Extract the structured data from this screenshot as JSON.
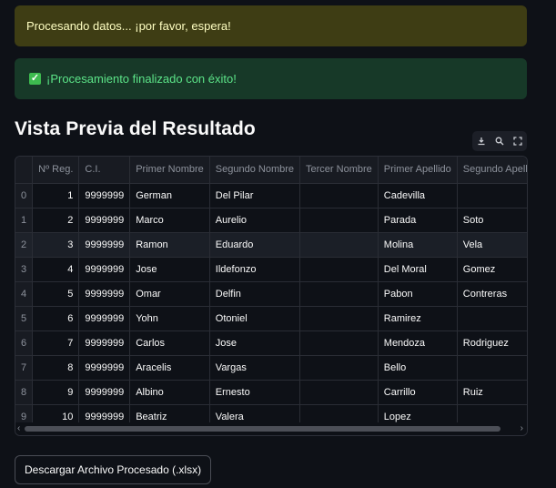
{
  "alerts": {
    "processing": "Procesando datos... ¡por favor, espera!",
    "success": "¡Procesamiento finalizado con éxito!"
  },
  "title": "Vista Previa del Resultado",
  "toolbar": {
    "icons": [
      "download-icon",
      "search-icon",
      "fullscreen-icon"
    ]
  },
  "table": {
    "columns": [
      "",
      "Nº Reg.",
      "C.I.",
      "Primer Nombre",
      "Segundo Nombre",
      "Tercer Nombre",
      "Primer Apellido",
      "Segundo Apellido"
    ],
    "rows": [
      [
        "0",
        "1",
        "9999999",
        "German",
        "Del Pilar",
        "",
        "Cadevilla",
        ""
      ],
      [
        "1",
        "2",
        "9999999",
        "Marco",
        "Aurelio",
        "",
        "Parada",
        "Soto"
      ],
      [
        "2",
        "3",
        "9999999",
        "Ramon",
        "Eduardo",
        "",
        "Molina",
        "Vela"
      ],
      [
        "3",
        "4",
        "9999999",
        "Jose",
        "Ildefonzo",
        "",
        "Del Moral",
        "Gomez"
      ],
      [
        "4",
        "5",
        "9999999",
        "Omar",
        "Delfin",
        "",
        "Pabon",
        "Contreras"
      ],
      [
        "5",
        "6",
        "9999999",
        "Yohn",
        "Otoniel",
        "",
        "Ramirez",
        ""
      ],
      [
        "6",
        "7",
        "9999999",
        "Carlos",
        "Jose",
        "",
        "Mendoza",
        "Rodriguez"
      ],
      [
        "7",
        "8",
        "9999999",
        "Aracelis",
        "Vargas",
        "",
        "Bello",
        ""
      ],
      [
        "8",
        "9",
        "9999999",
        "Albino",
        "Ernesto",
        "",
        "Carrillo",
        "Ruiz"
      ],
      [
        "9",
        "10",
        "9999999",
        "Beatriz",
        "Valera",
        "",
        "Lopez",
        ""
      ]
    ]
  },
  "download_button": "Descargar Archivo Procesado (.xlsx)",
  "colors": {
    "background": "#0e1117",
    "warning_bg": "#3e3d14",
    "warning_text": "#ffffc2",
    "success_bg": "#173928",
    "success_text": "#5ce488"
  }
}
